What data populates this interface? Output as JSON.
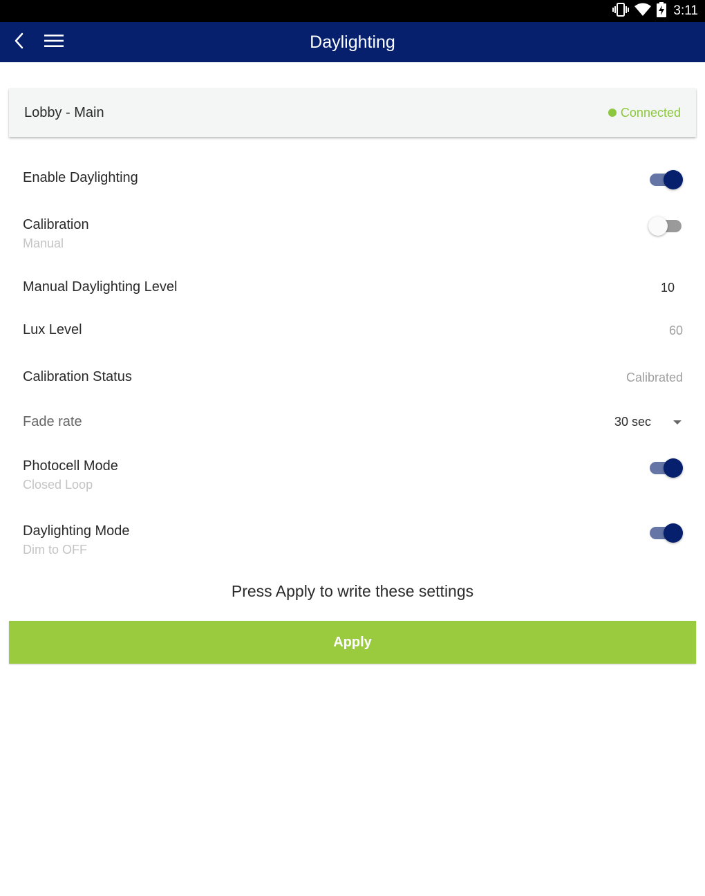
{
  "status_bar": {
    "time": "3:11",
    "icons": [
      "vibrate-icon",
      "wifi-icon",
      "battery-charging-icon"
    ]
  },
  "app_bar": {
    "title": "Daylighting",
    "back_icon": "chevron-left-icon",
    "menu_icon": "hamburger-menu-icon",
    "background": "#06206e"
  },
  "device": {
    "name": "Lobby - Main",
    "connection_status": "Connected",
    "status_color": "#8dc63f"
  },
  "settings": {
    "enable_daylighting": {
      "label": "Enable Daylighting",
      "enabled": true
    },
    "calibration": {
      "label": "Calibration",
      "sublabel": "Manual",
      "enabled": false
    },
    "manual_level": {
      "label": "Manual Daylighting Level",
      "value": "10"
    },
    "lux_level": {
      "label": "Lux Level",
      "value": "60"
    },
    "calibration_status": {
      "label": "Calibration Status",
      "value": "Calibrated"
    },
    "fade_rate": {
      "label": "Fade rate",
      "selected": "30 sec"
    },
    "photocell_mode": {
      "label": "Photocell Mode",
      "sublabel": "Closed Loop",
      "enabled": true
    },
    "daylighting_mode": {
      "label": "Daylighting Mode",
      "sublabel": "Dim to OFF",
      "enabled": true
    }
  },
  "footer": {
    "hint": "Press Apply to write these settings",
    "apply_label": "Apply",
    "apply_color": "#9acb3f"
  }
}
